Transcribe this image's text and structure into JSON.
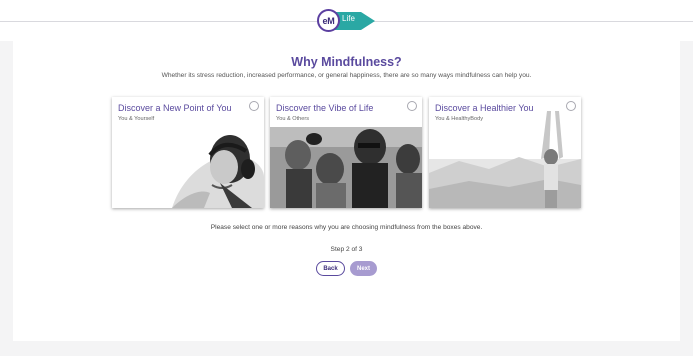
{
  "brand": {
    "logo_mark": "eM",
    "logo_word": "Life",
    "primary_color": "#5a4a9e",
    "accent_color": "#2aa8a4"
  },
  "page": {
    "title": "Why Mindfulness?",
    "subtitle": "Whether its stress reduction, increased performance, or general happiness, there are so many ways mindfulness can help you."
  },
  "cards": [
    {
      "title": "Discover a New Point of You",
      "subtitle": "You & Yourself",
      "selected": false,
      "image": "woman-with-headphones-photo"
    },
    {
      "title": "Discover the Vibe of Life",
      "subtitle": "You & Others",
      "selected": false,
      "image": "friends-group-photo"
    },
    {
      "title": "Discover a Healthier You",
      "subtitle": "You & HealthyBody",
      "selected": false,
      "image": "woman-stretching-photo"
    }
  ],
  "instructions": "Please select one or more reasons why you are choosing mindfulness from the boxes above.",
  "step_label": "Step 2 of 3",
  "buttons": {
    "back": "Back",
    "next": "Next"
  }
}
